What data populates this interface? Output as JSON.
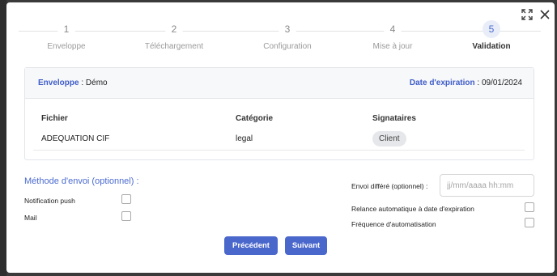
{
  "stepper": {
    "steps": [
      {
        "num": "1",
        "label": "Enveloppe"
      },
      {
        "num": "2",
        "label": "Téléchargement"
      },
      {
        "num": "3",
        "label": "Configuration"
      },
      {
        "num": "4",
        "label": "Mise à jour"
      },
      {
        "num": "5",
        "label": "Validation"
      }
    ],
    "active_step": 5
  },
  "summary": {
    "envelope_label": "Enveloppe",
    "envelope_sep": " : ",
    "envelope_value": "Démo",
    "expiry_label": "Date d'expiration",
    "expiry_sep": " : ",
    "expiry_value": "09/01/2024"
  },
  "table": {
    "headers": [
      "Fichier",
      "Catégorie",
      "Signataires"
    ],
    "rows": [
      {
        "file": "ADEQUATION CIF",
        "category": "legal",
        "signer": "Client"
      }
    ]
  },
  "send_method": {
    "title": "Méthode d'envoi (optionnel) :",
    "options": [
      "Notification push",
      "Mail"
    ]
  },
  "deferred": {
    "label": "Envoi différé (optionnel) :",
    "placeholder": "jj/mm/aaaa hh:mm"
  },
  "automation": {
    "options": [
      "Relance automatique à date d'expiration",
      "Fréquence d'automatisation"
    ]
  },
  "buttons": {
    "previous": "Précédent",
    "next": "Suivant"
  },
  "icons": {
    "expand": "expand-icon",
    "close": "close-icon"
  },
  "colors": {
    "accent": "#4a67cc",
    "label_blue": "#3e5cc8"
  }
}
